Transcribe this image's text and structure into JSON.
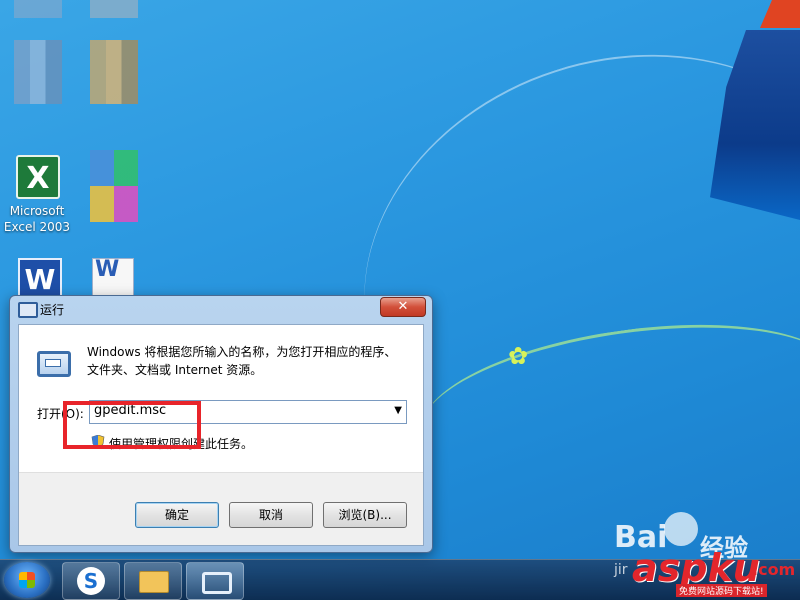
{
  "desktop": {
    "icons": [
      {
        "label": "Microsoft\nExcel 2003",
        "icon": "excel-icon"
      }
    ]
  },
  "dialog": {
    "title": "运行",
    "close_symbol": "✕",
    "description": "Windows 将根据您所输入的名称，为您打开相应的程序、文件夹、文档或 Internet 资源。",
    "open_label": "打开(O):",
    "input_value": "gpedit.msc",
    "admin_note": "使用管理权限创建此任务。",
    "buttons": {
      "ok": "确定",
      "cancel": "取消",
      "browse": "浏览(B)..."
    }
  },
  "watermark": {
    "baidu": "Bai",
    "jingyan": "经验",
    "jir": "jir",
    "aspku": "aspku",
    "aspku_tld": ".com",
    "aspku_tagline": "免费网站源码下载站!"
  },
  "colors": {
    "highlight": "#e8242a",
    "desktop": "#2b98e0"
  }
}
